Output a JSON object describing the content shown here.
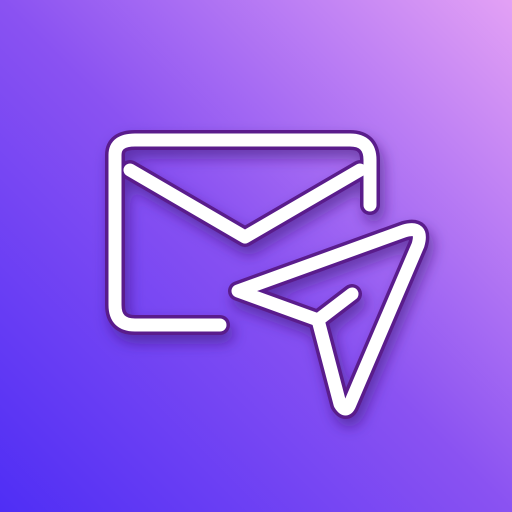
{
  "icon": {
    "name": "send-mail-icon",
    "glyph_color": "#ffffff",
    "outline_color": "#5a1f8c",
    "shadow_color": "#3a1670",
    "background": {
      "style": "diagonal-gradient",
      "from": "#4f2ef5",
      "mid": "#8a52f2",
      "to": "#e3a1f5"
    }
  }
}
